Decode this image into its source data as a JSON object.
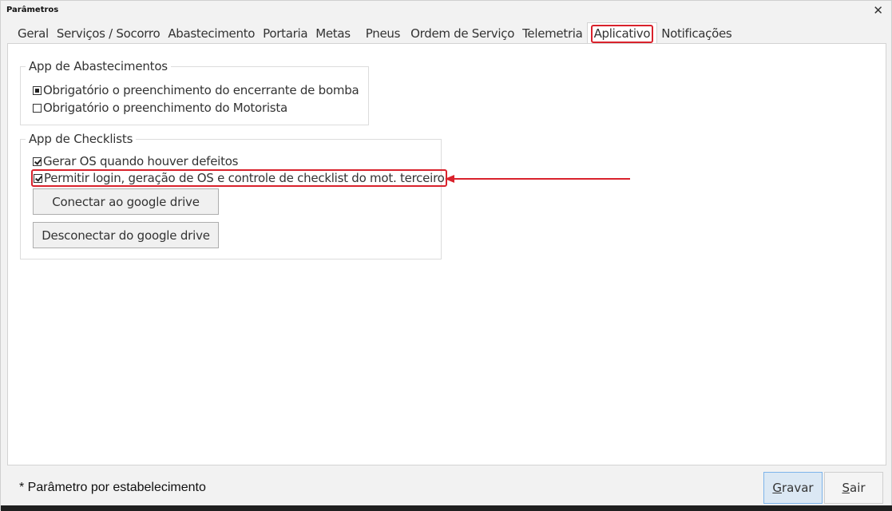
{
  "window": {
    "title": "Parâmetros",
    "close_glyph": "✕"
  },
  "tabs": [
    {
      "label": "Geral"
    },
    {
      "label": "Serviços / Socorro"
    },
    {
      "label": "Abastecimento"
    },
    {
      "label": "Portaria"
    },
    {
      "label": "Metas"
    },
    {
      "label": "Pneus"
    },
    {
      "label": "Ordem de Serviço"
    },
    {
      "label": "Telemetria"
    },
    {
      "label": "Aplicativo",
      "active": true,
      "highlighted": true
    },
    {
      "label": "Notificações"
    }
  ],
  "groups": {
    "abastecimentos": {
      "title": "App de Abastecimentos",
      "options": [
        {
          "label": "Obrigatório o preenchimento do encerrante de bomba",
          "state": "indeterminate"
        },
        {
          "label": "Obrigatório o preenchimento do Motorista",
          "state": "unchecked"
        }
      ]
    },
    "checklists": {
      "title": "App de Checklists",
      "options": [
        {
          "label": "Gerar OS quando houver defeitos",
          "state": "checked"
        },
        {
          "label": "Permitir login, geração de OS e controle de checklist do mot. terceiro",
          "state": "checked",
          "highlighted": true
        }
      ],
      "buttons": {
        "connect": "Conectar ao google drive",
        "disconnect": "Desconectar do google drive"
      }
    }
  },
  "footer": {
    "note": "* Parâmetro por estabelecimento",
    "save_label_first": "G",
    "save_label_rest": "ravar",
    "exit_label_first": "S",
    "exit_label_rest": "air"
  },
  "colors": {
    "highlight": "#d9222c",
    "primary_button_bg": "#dbe8f4",
    "primary_button_border": "#7eb4ea"
  }
}
